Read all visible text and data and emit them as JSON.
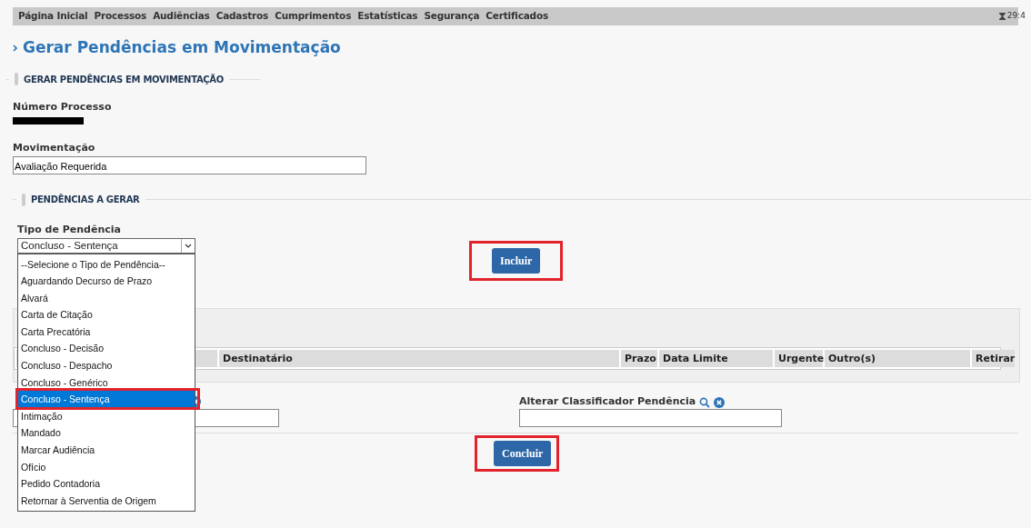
{
  "menu": [
    {
      "label": "Página Inicial"
    },
    {
      "label": "Processos"
    },
    {
      "label": "Audiências"
    },
    {
      "label": "Cadastros"
    },
    {
      "label": "Cumprimentos"
    },
    {
      "label": "Estatísticas"
    },
    {
      "label": "Segurança"
    },
    {
      "label": "Certificados"
    }
  ],
  "clock": "29:4",
  "page_title": "Gerar Pendências em Movimentação",
  "section": {
    "legend": "GERAR PENDÊNCIAS EM MOVIMENTAÇÃO",
    "numero_label": "Número Processo",
    "movimentacao_label": "Movimentação",
    "movimentacao_value": "Avaliação Requerida"
  },
  "pendencias": {
    "legend": "PENDÊNCIAS A GERAR",
    "tipo_label": "Tipo de Pendência",
    "tipo_value": "Concluso - Sentença",
    "options": [
      {
        "label": "--Selecione o Tipo de Pendência--",
        "selected": false,
        "annotated": false
      },
      {
        "label": "Aguardando Decurso de Prazo",
        "selected": false,
        "annotated": false
      },
      {
        "label": "Alvará",
        "selected": false,
        "annotated": false
      },
      {
        "label": "Carta de Citação",
        "selected": false,
        "annotated": false
      },
      {
        "label": "Carta Precatória",
        "selected": false,
        "annotated": false
      },
      {
        "label": "Concluso - Decisão",
        "selected": false,
        "annotated": false
      },
      {
        "label": "Concluso - Despacho",
        "selected": false,
        "annotated": false
      },
      {
        "label": "Concluso - Genérico",
        "selected": false,
        "annotated": false
      },
      {
        "label": "Concluso - Sentença",
        "selected": true,
        "annotated": true
      },
      {
        "label": "Intimação",
        "selected": false,
        "annotated": false
      },
      {
        "label": "Mandado",
        "selected": false,
        "annotated": false
      },
      {
        "label": "Marcar Audiência",
        "selected": false,
        "annotated": false
      },
      {
        "label": "Ofício",
        "selected": false,
        "annotated": false
      },
      {
        "label": "Pedido Contadoria",
        "selected": false,
        "annotated": false
      },
      {
        "label": "Retornar à Serventia de Origem",
        "selected": false,
        "annotated": false
      }
    ],
    "add_button": {
      "label": "Incluir",
      "annotated": true
    },
    "table_columns": [
      "Destinatário",
      "Prazo",
      "Data Limite",
      "Urgente",
      "Outro(s)",
      "Retirar"
    ],
    "classificador_label": "Alterar Classificador Pendência"
  },
  "submit_button": {
    "label": "Concluir",
    "annotated": true
  }
}
